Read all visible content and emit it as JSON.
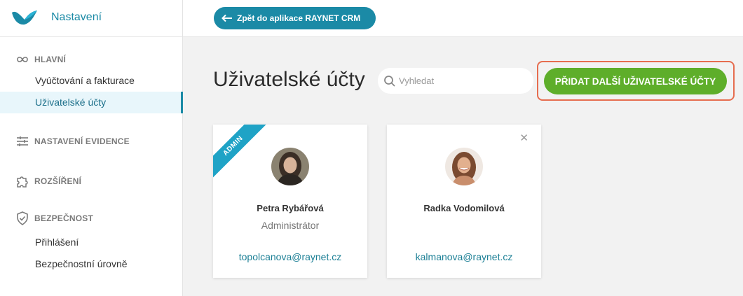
{
  "app": {
    "title": "Nastavení"
  },
  "sidebar": {
    "sections": [
      {
        "label": "HLAVNÍ",
        "icon": "infinity-icon",
        "items": [
          "Vyúčtování a fakturace",
          "Uživatelské účty"
        ]
      },
      {
        "label": "NASTAVENÍ EVIDENCE",
        "icon": "sliders-icon",
        "items": []
      },
      {
        "label": "ROZŠÍŘENÍ",
        "icon": "puzzle-icon",
        "items": []
      },
      {
        "label": "BEZPEČNOST",
        "icon": "shield-icon",
        "items": [
          "Přihlášení",
          "Bezpečnostní úrovně"
        ]
      }
    ],
    "active_item": "Uživatelské účty"
  },
  "topbar": {
    "back_label": "Zpět do aplikace RAYNET CRM"
  },
  "main": {
    "title": "Uživatelské účty",
    "search": {
      "placeholder": "Vyhledat",
      "value": ""
    },
    "add_label": "PŘIDAT DALŠÍ UŽIVATELSKÉ ÚČTY"
  },
  "users": [
    {
      "badge": "ADMIN",
      "name": "Petra Rybářová",
      "role": "Administrátor",
      "email": "topolcanova@raynet.cz"
    },
    {
      "badge": "",
      "name": "Radka Vodomilová",
      "role": "",
      "email": "kalmanova@raynet.cz"
    }
  ],
  "colors": {
    "brand": "#1b8aa6",
    "accent_green": "#5eae2a",
    "highlight": "#e66d4f",
    "ribbon": "#1fa3c6"
  }
}
